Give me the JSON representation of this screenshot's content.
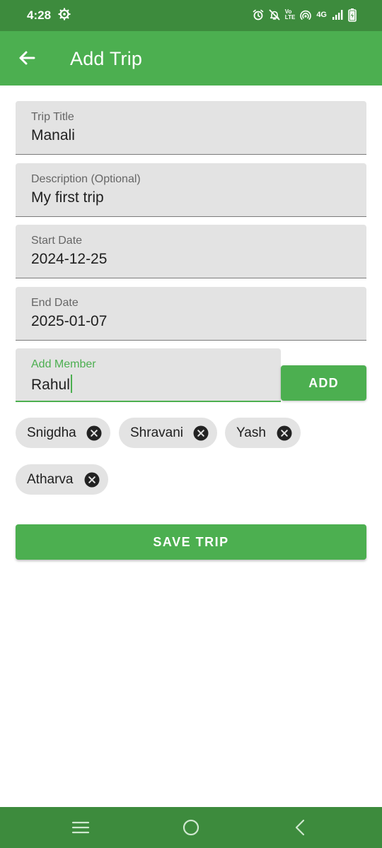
{
  "status_bar": {
    "time": "4:28",
    "network_top": "Vo",
    "network_bottom": "LTE",
    "network_type": "4G",
    "icons": [
      "settings-gear-icon",
      "alarm-icon",
      "notifications-off-icon",
      "hotspot-icon",
      "signal-icon",
      "battery-charging-icon"
    ]
  },
  "app_bar": {
    "title": "Add Trip",
    "back_icon": "arrow-back-icon"
  },
  "form": {
    "title_field": {
      "label": "Trip Title",
      "value": "Manali"
    },
    "description_field": {
      "label": "Description (Optional)",
      "value": "My first trip"
    },
    "start_date_field": {
      "label": "Start Date",
      "value": "2024-12-25"
    },
    "end_date_field": {
      "label": "End Date",
      "value": "2025-01-07"
    },
    "member_field": {
      "label": "Add Member",
      "value": "Rahul"
    },
    "add_button": "ADD"
  },
  "members": [
    "Snigdha",
    "Shravani",
    "Yash",
    "Atharva"
  ],
  "save_button": "SAVE TRIP",
  "nav_bar": {
    "icons": [
      "recents-menu-icon",
      "home-circle-icon",
      "back-chevron-icon"
    ]
  },
  "colors": {
    "primary": "#4caf50",
    "status_bar": "#3d8b3d",
    "field_bg": "#e3e3e3",
    "chip_bg": "#e3e3e3"
  }
}
